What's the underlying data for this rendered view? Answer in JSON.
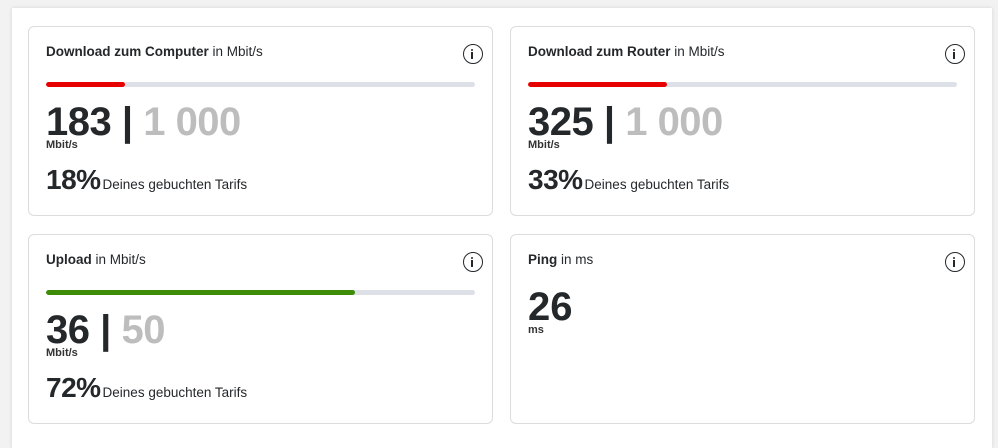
{
  "colors": {
    "red": "#e60000",
    "green": "#3d8b07",
    "track": "#dde0e7"
  },
  "download_computer": {
    "title": "Download zum Computer",
    "unit_label": "in Mbit/s",
    "icon": "info-icon",
    "value": "183",
    "separator": "|",
    "max": "1 000",
    "value_unit": "Mbit/s",
    "percent": "18%",
    "percent_text": "Deines gebuchten Tarifs",
    "progress_fraction": 0.183
  },
  "download_router": {
    "title": "Download zum Router",
    "unit_label": "in Mbit/s",
    "icon": "info-icon",
    "value": "325",
    "separator": "|",
    "max": "1 000",
    "value_unit": "Mbit/s",
    "percent": "33%",
    "percent_text": "Deines gebuchten Tarifs",
    "progress_fraction": 0.325
  },
  "upload": {
    "title": "Upload",
    "unit_label": "in Mbit/s",
    "icon": "info-icon",
    "value": "36",
    "separator": "|",
    "max": "50",
    "value_unit": "Mbit/s",
    "percent": "72%",
    "percent_text": "Deines gebuchten Tarifs",
    "progress_fraction": 0.72
  },
  "ping": {
    "title": "Ping",
    "unit_label": "in ms",
    "icon": "info-icon",
    "value": "26",
    "value_unit": "ms"
  }
}
